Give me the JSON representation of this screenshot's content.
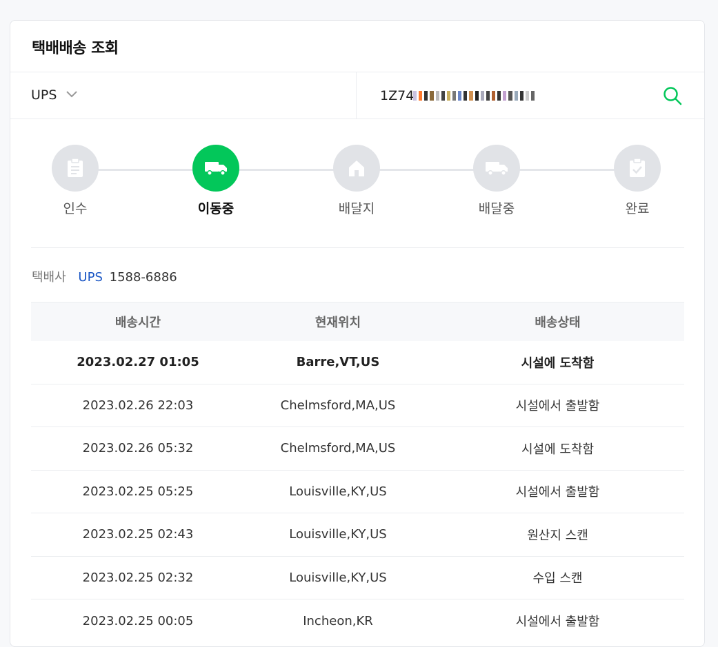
{
  "page": {
    "title": "택배배송 조회"
  },
  "search": {
    "carrier": "UPS",
    "tracking_number": "1Z74"
  },
  "steps": [
    {
      "label": "인수",
      "icon": "document-icon",
      "active": false
    },
    {
      "label": "이동중",
      "icon": "truck-icon",
      "active": true
    },
    {
      "label": "배달지",
      "icon": "house-icon",
      "active": false
    },
    {
      "label": "배달중",
      "icon": "delivery-truck-icon",
      "active": false
    },
    {
      "label": "완료",
      "icon": "checklist-icon",
      "active": false
    }
  ],
  "company": {
    "label": "택배사",
    "name": "UPS",
    "phone": "1588-6886"
  },
  "table": {
    "headers": [
      "배송시간",
      "현재위치",
      "배송상태"
    ],
    "rows": [
      {
        "time": "2023.02.27 01:05",
        "location": "Barre,VT,US",
        "status": "시설에 도착함"
      },
      {
        "time": "2023.02.26 22:03",
        "location": "Chelmsford,MA,US",
        "status": "시설에서 출발함"
      },
      {
        "time": "2023.02.26 05:32",
        "location": "Chelmsford,MA,US",
        "status": "시설에 도착함"
      },
      {
        "time": "2023.02.25 05:25",
        "location": "Louisville,KY,US",
        "status": "시설에서 출발함"
      },
      {
        "time": "2023.02.25 02:43",
        "location": "Louisville,KY,US",
        "status": "원산지 스캔"
      },
      {
        "time": "2023.02.25 02:32",
        "location": "Louisville,KY,US",
        "status": "수입 스캔"
      },
      {
        "time": "2023.02.25 00:05",
        "location": "Incheon,KR",
        "status": "시설에서 출발함"
      }
    ]
  },
  "colors": {
    "accent": "#03c75a",
    "link": "#1a56c4",
    "inactive_step": "#e1e3e7"
  }
}
